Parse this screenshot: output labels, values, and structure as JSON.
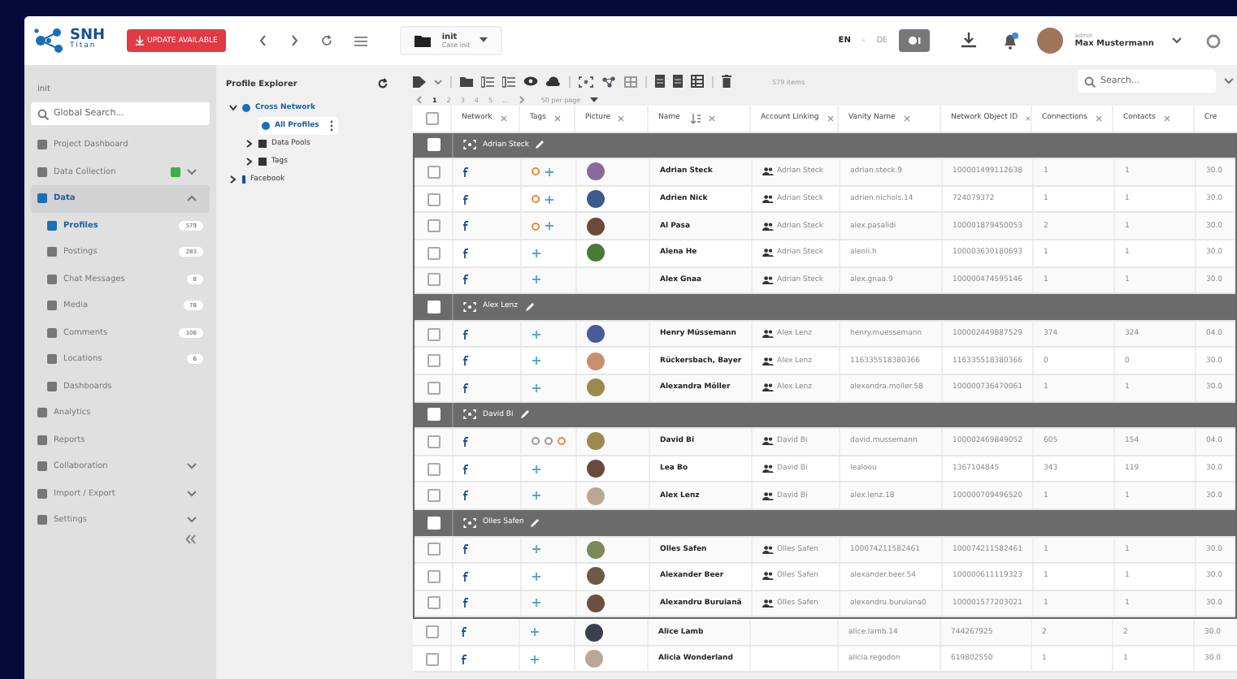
{
  "topbar": {
    "logo": {
      "title": "SNH",
      "subtitle": "Titan"
    },
    "update_button": "UPDATE AVAILABLE",
    "case": {
      "title": "init",
      "subtitle": "Case init"
    },
    "languages": [
      {
        "label": "EN",
        "selected": true
      },
      {
        "label": "DE",
        "selected": false
      }
    ],
    "language_separator": "-",
    "user": {
      "role": "admin",
      "name": "Max Mustermann"
    }
  },
  "sidebar": {
    "project": "init",
    "search": {
      "placeholder": "Global Search..."
    },
    "items": [
      {
        "label": "Project Dashboard",
        "selected": false
      },
      {
        "label": "Data Collection",
        "selected": false,
        "status": true,
        "expanded": false
      },
      {
        "label": "Data",
        "selected": true,
        "expanded": true,
        "children": [
          {
            "label": "Profiles",
            "selected": true,
            "count": "579"
          },
          {
            "label": "Postings",
            "selected": false,
            "count": "283"
          },
          {
            "label": "Chat Messages",
            "selected": false,
            "count": "8"
          },
          {
            "label": "Media",
            "selected": false,
            "count": "78"
          },
          {
            "label": "Comments",
            "selected": false,
            "count": "106"
          },
          {
            "label": "Locations",
            "selected": false,
            "count": "6"
          },
          {
            "label": "Dashboards",
            "selected": false
          }
        ]
      },
      {
        "label": "Analytics",
        "selected": false
      },
      {
        "label": "Reports",
        "selected": false
      },
      {
        "label": "Collaboration",
        "selected": false,
        "expanded": false
      },
      {
        "label": "Import / Export",
        "selected": false,
        "expanded": false
      },
      {
        "label": "Settings",
        "selected": false,
        "expanded": false
      }
    ]
  },
  "explorer": {
    "title": "Profile Explorer",
    "tree": [
      {
        "label": "Cross Network",
        "expanded": true,
        "children": [
          {
            "label": "All Profiles",
            "selected": true
          },
          {
            "label": "Data Pools",
            "expanded": false,
            "selected": false
          },
          {
            "label": "Tags",
            "expanded": false,
            "selected": false
          }
        ]
      },
      {
        "label": "Facebook",
        "expanded": false
      }
    ]
  },
  "toolbar": {
    "pages": [
      {
        "label": "1",
        "selected": true
      },
      {
        "label": "2",
        "selected": false
      },
      {
        "label": "3",
        "selected": false
      },
      {
        "label": "4",
        "selected": false
      },
      {
        "label": "5",
        "selected": false
      },
      {
        "label": "...",
        "selected": false
      }
    ],
    "per_page": "50 per page",
    "item_count": "579 items",
    "search": {
      "placeholder": "Search..."
    }
  },
  "table": {
    "all_checked": false,
    "columns": [
      "Network",
      "Tags",
      "Picture",
      "Name",
      "Account Linking",
      "Vanity Name",
      "Network Object ID",
      "Connections",
      "Contacts",
      "Cre"
    ],
    "groups": [
      {
        "name": "Adrian Steck",
        "checked": false,
        "rows": [
          {
            "checked": false,
            "name": "Adrian Steck",
            "tags": [
              {
                "color": "#f0883a"
              }
            ],
            "add_tag": true,
            "picture": true,
            "link": "Adrian Steck",
            "vanity": "adrian.steck.9",
            "object_id": "100001499112638",
            "connections": "1",
            "contacts": "1",
            "created": "30.0"
          },
          {
            "checked": false,
            "name": "Adrien Nick",
            "tags": [
              {
                "color": "#f0883a"
              }
            ],
            "add_tag": true,
            "picture": true,
            "link": "Adrian Steck",
            "vanity": "adrien.nichols.14",
            "object_id": "724079372",
            "connections": "1",
            "contacts": "1",
            "created": "30.0"
          },
          {
            "checked": false,
            "name": "Al Pasa",
            "tags": [
              {
                "color": "#f0883a"
              }
            ],
            "add_tag": true,
            "picture": true,
            "link": "Adrian Steck",
            "vanity": "alex.pasalidi",
            "object_id": "100001879450053",
            "connections": "2",
            "contacts": "1",
            "created": "30.0"
          },
          {
            "checked": false,
            "name": "Alena He",
            "tags": [],
            "add_tag": true,
            "picture": true,
            "link": "Adrian Steck",
            "vanity": "alenii.h",
            "object_id": "100003630180693",
            "connections": "1",
            "contacts": "1",
            "created": "30.0"
          },
          {
            "checked": false,
            "name": "Alex Gnaa",
            "tags": [],
            "add_tag": true,
            "picture": false,
            "link": "Adrian Steck",
            "vanity": "alex.gnaa.9",
            "object_id": "100000474595146",
            "connections": "1",
            "contacts": "1",
            "created": "30.0"
          }
        ]
      },
      {
        "name": "Alex Lenz",
        "checked": false,
        "rows": [
          {
            "checked": false,
            "name": "Henry Müssemann",
            "tags": [],
            "add_tag": true,
            "picture": true,
            "link": "Alex Lenz",
            "vanity": "henry.muessemann",
            "object_id": "100002449887529",
            "connections": "374",
            "contacts": "324",
            "created": "04.0"
          },
          {
            "checked": false,
            "name": "Rückersbach, Bayer",
            "tags": [],
            "add_tag": true,
            "picture": true,
            "link": "Alex Lenz",
            "vanity": "116335518380366",
            "object_id": "116335518380366",
            "connections": "0",
            "contacts": "0",
            "created": "30.0"
          },
          {
            "checked": false,
            "name": "Alexandra Möller",
            "tags": [],
            "add_tag": true,
            "picture": true,
            "link": "Alex Lenz",
            "vanity": "alexandra.moller.58",
            "object_id": "100000736470061",
            "connections": "1",
            "contacts": "1",
            "created": "30.0"
          }
        ]
      },
      {
        "name": "David Bi",
        "checked": false,
        "rows": [
          {
            "checked": false,
            "name": "David Bi",
            "tags": [
              {
                "color": "#9a9a9a"
              },
              {
                "color": "#9a9a9a"
              },
              {
                "color": "#f0883a"
              }
            ],
            "add_tag": false,
            "picture": true,
            "link": "David Bi",
            "vanity": "david.mussemann",
            "object_id": "100002469849052",
            "connections": "605",
            "contacts": "154",
            "created": "04.0"
          },
          {
            "checked": false,
            "name": "Lea Bo",
            "tags": [],
            "add_tag": true,
            "picture": true,
            "link": "David Bi",
            "vanity": "lealoou",
            "object_id": "1367104845",
            "connections": "343",
            "contacts": "119",
            "created": "30.0"
          },
          {
            "checked": false,
            "name": "Alex Lenz",
            "tags": [],
            "add_tag": true,
            "picture": true,
            "link": "David Bi",
            "vanity": "alex.lenz.18",
            "object_id": "100000709496520",
            "connections": "1",
            "contacts": "1",
            "created": "30.0"
          }
        ]
      },
      {
        "name": "Olles Safen",
        "checked": false,
        "rows": [
          {
            "checked": false,
            "name": "Olles Safen",
            "tags": [],
            "add_tag": true,
            "picture": true,
            "link": "Olles Safen",
            "vanity": "100074211582461",
            "object_id": "100074211582461",
            "connections": "1",
            "contacts": "1",
            "created": "30.0"
          },
          {
            "checked": false,
            "name": "Alexander Beer",
            "tags": [],
            "add_tag": true,
            "picture": true,
            "link": "Olles Safen",
            "vanity": "alexander.beer.54",
            "object_id": "100000611119323",
            "connections": "1",
            "contacts": "1",
            "created": "30.0"
          },
          {
            "checked": false,
            "name": "Alexandru Buruianä",
            "tags": [],
            "add_tag": true,
            "picture": true,
            "link": "Olles Safen",
            "vanity": "alexandru.buruiana0",
            "object_id": "100001577203021",
            "connections": "1",
            "contacts": "1",
            "created": "30.0"
          }
        ]
      }
    ],
    "rows": [
      {
        "checked": false,
        "name": "Alice Lamb",
        "tags": [],
        "add_tag": true,
        "picture": true,
        "vanity": "alice.lamb.14",
        "object_id": "744267925",
        "connections": "2",
        "contacts": "2",
        "created": "30.0"
      },
      {
        "checked": false,
        "name": "Alicia Wonderland",
        "tags": [],
        "add_tag": true,
        "picture": true,
        "vanity": "alicia.regodon",
        "object_id": "619802550",
        "connections": "1",
        "contacts": "1",
        "created": "30.0"
      }
    ]
  }
}
